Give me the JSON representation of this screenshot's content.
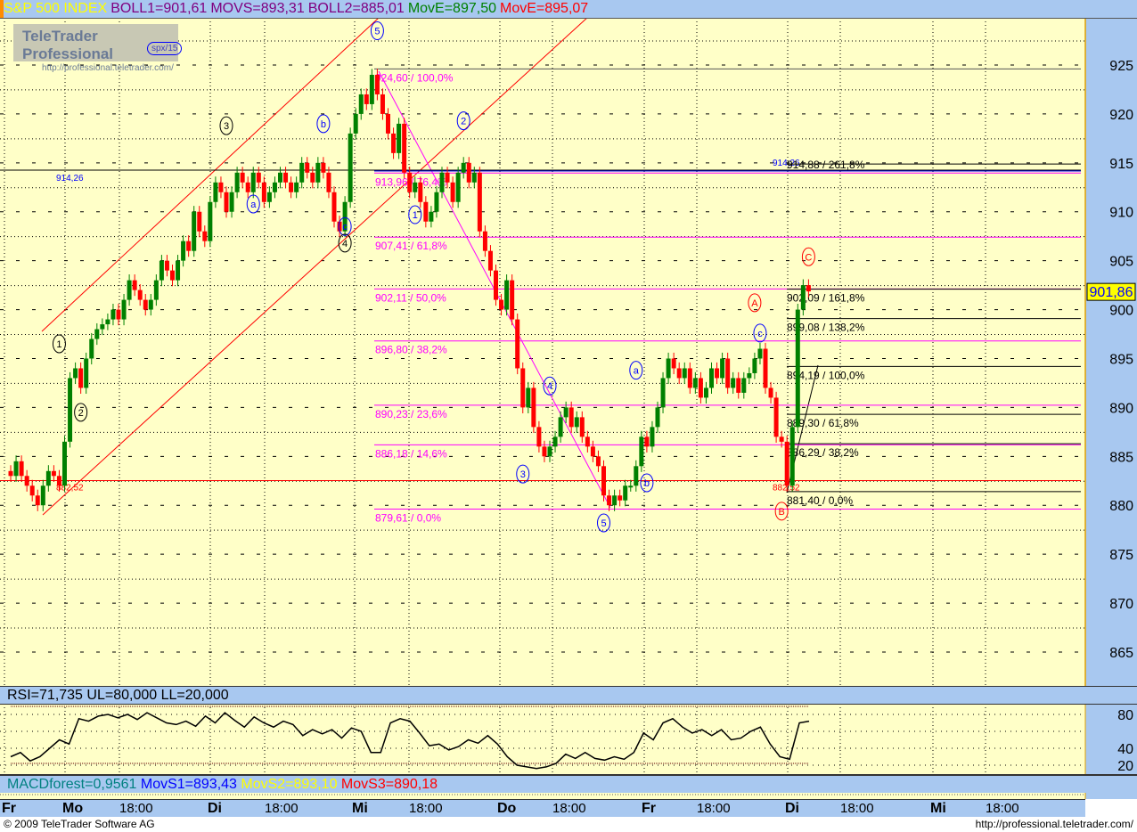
{
  "header": {
    "symbol": "S&P 500 INDEX",
    "boll1": "BOLL1=901,61",
    "movs": "MOVS=893,31",
    "boll2": "BOLL2=885,01",
    "move1": "MovE=897,50",
    "move2": "MovE=895,07"
  },
  "logo": {
    "title": "TeleTrader Professional",
    "url": "http://professional.teletrader.com/",
    "badge": "spx/15"
  },
  "rsi_header": "RSI=71,735 UL=80,000 LL=20,000",
  "macd_header": {
    "macd": "MACDforest=0,9561",
    "movs1": "MovS1=893,43",
    "movs2": "MovS2=893,10",
    "movs3": "MovS3=890,18"
  },
  "footer": {
    "copyright": "© 2009 TeleTrader Software AG",
    "url": "http://professional.teletrader.com/"
  },
  "colors": {
    "bg": "#ffffc8",
    "panel": "#a8c8f0",
    "up": "#008000",
    "down": "#ff0000",
    "fib": "#ff00ff"
  },
  "chart_data": {
    "type": "candlestick",
    "title": "S&P 500 INDEX",
    "ylim": [
      861,
      927
    ],
    "y_ticks": [
      "925",
      "920",
      "915",
      "910",
      "905",
      "900",
      "895",
      "890",
      "885",
      "880",
      "875",
      "870",
      "865"
    ],
    "last_price": "901,86",
    "x_ticks": [
      {
        "label": "Fr",
        "major": true
      },
      {
        "label": "Mo",
        "major": true
      },
      {
        "label": "18:00",
        "major": false
      },
      {
        "label": "Di",
        "major": true
      },
      {
        "label": "18:00",
        "major": false
      },
      {
        "label": "Mi",
        "major": true
      },
      {
        "label": "18:00",
        "major": false
      },
      {
        "label": "Do",
        "major": true
      },
      {
        "label": "18:00",
        "major": false
      },
      {
        "label": "Fr",
        "major": true
      },
      {
        "label": "18:00",
        "major": false
      },
      {
        "label": "Di",
        "major": true
      },
      {
        "label": "18:00",
        "major": false
      },
      {
        "label": "Mi",
        "major": true
      },
      {
        "label": "18:00",
        "major": false
      }
    ],
    "closes": [
      883,
      884.5,
      883,
      882,
      881,
      880,
      882,
      883.5,
      883,
      882,
      886.5,
      893,
      894,
      892,
      895,
      897,
      898,
      898.5,
      899,
      900,
      899,
      901,
      903,
      902,
      901,
      900,
      901,
      903,
      905,
      904,
      903,
      905,
      907,
      906,
      910,
      908,
      907,
      911,
      913,
      912,
      910,
      912,
      914,
      913,
      912,
      914,
      913,
      911,
      912,
      913,
      914,
      913,
      912,
      913,
      915,
      914,
      913,
      915,
      914,
      912,
      909,
      908,
      911,
      918,
      920,
      922,
      921,
      924,
      922,
      920,
      918,
      916,
      919,
      914,
      912,
      913,
      911,
      909,
      910,
      912,
      914,
      913,
      911,
      914,
      915,
      913,
      914,
      908,
      906,
      904,
      901,
      900,
      903,
      899,
      894,
      890,
      892,
      888,
      886,
      885,
      886,
      887,
      889,
      890,
      888,
      889,
      887,
      886,
      885,
      884,
      881,
      880,
      881,
      880.5,
      882,
      882,
      884,
      887,
      886,
      888,
      890,
      893,
      895,
      894,
      893,
      894,
      892,
      893,
      891,
      892,
      894,
      893,
      895,
      892,
      893,
      891.5,
      893,
      893.5,
      895,
      896,
      892,
      891,
      887,
      886.5,
      882,
      888,
      900,
      902.5,
      901.86
    ],
    "horizontal_levels": [
      {
        "label": "914,26",
        "price": 914.26,
        "color": "#0000ff"
      },
      {
        "label": "882,52",
        "price": 882.52,
        "color": "#ff0000"
      }
    ],
    "fib_retracement": [
      {
        "label": "924,60 / 100,0%",
        "price": 924.6
      },
      {
        "label": "913,96 / 76,4%",
        "price": 913.96
      },
      {
        "label": "907,41 / 61,8%",
        "price": 907.41
      },
      {
        "label": "902,11 / 50,0%",
        "price": 902.11
      },
      {
        "label": "896,80 / 38,2%",
        "price": 896.8
      },
      {
        "label": "890,23 / 23,6%",
        "price": 890.23
      },
      {
        "label": "886,18 / 14,6%",
        "price": 886.18
      },
      {
        "label": "879,61 / 0,0%",
        "price": 879.61
      }
    ],
    "fib_extension": [
      {
        "label": "914,88 / 261,8%",
        "price": 914.88
      },
      {
        "label": "902,09 / 161,8%",
        "price": 902.09
      },
      {
        "label": "899,08 / 138,2%",
        "price": 899.08
      },
      {
        "label": "894,19 / 100,0%",
        "price": 894.19
      },
      {
        "label": "889,30 / 61,8%",
        "price": 889.3
      },
      {
        "label": "886,29 / 38,2%",
        "price": 886.29
      },
      {
        "label": "881,40 / 0,0%",
        "price": 881.4
      }
    ],
    "wave_labels": [
      {
        "text": "1",
        "color": "#000000",
        "bar": 10,
        "price": 896.5
      },
      {
        "text": "2",
        "color": "#000000",
        "bar": 14,
        "price": 889.5
      },
      {
        "text": "3",
        "color": "#000000",
        "bar": 41,
        "price": 918.8
      },
      {
        "text": "a",
        "color": "#0000ff",
        "bar": 46,
        "price": 910.8
      },
      {
        "text": "b",
        "color": "#0000ff",
        "bar": 59,
        "price": 919
      },
      {
        "text": "c",
        "color": "#0000ff",
        "bar": 63,
        "price": 908.5
      },
      {
        "text": "4",
        "color": "#000000",
        "bar": 63,
        "price": 906.8
      },
      {
        "text": "5",
        "color": "#0000ff",
        "bar": 69,
        "price": 928.5
      },
      {
        "text": "1",
        "color": "#0000ff",
        "bar": 76,
        "price": 909.7
      },
      {
        "text": "2",
        "color": "#0000ff",
        "bar": 85,
        "price": 919.3
      },
      {
        "text": "4",
        "color": "#0000ff",
        "bar": 101,
        "price": 892.2
      },
      {
        "text": "3",
        "color": "#0000ff",
        "bar": 96,
        "price": 883.2
      },
      {
        "text": "5",
        "color": "#0000ff",
        "bar": 111,
        "price": 878.2
      },
      {
        "text": "a",
        "color": "#0000ff",
        "bar": 117,
        "price": 893.8
      },
      {
        "text": "b",
        "color": "#0000ff",
        "bar": 119,
        "price": 882.3
      },
      {
        "text": "c",
        "color": "#0000ff",
        "bar": 140,
        "price": 897.6
      },
      {
        "text": "A",
        "color": "#ff0000",
        "bar": 139,
        "price": 900.7
      },
      {
        "text": "B",
        "color": "#ff0000",
        "bar": 144,
        "price": 879.4
      },
      {
        "text": "C",
        "color": "#ff0000",
        "bar": 149,
        "price": 905.4
      }
    ],
    "rsi": {
      "ylim": [
        20,
        80
      ],
      "ticks": [
        "80",
        "40",
        "20"
      ],
      "values": [
        30,
        35,
        25,
        30,
        40,
        50,
        45,
        75,
        72,
        78,
        80,
        76,
        80,
        74,
        82,
        76,
        70,
        68,
        72,
        66,
        78,
        70,
        82,
        73,
        65,
        77,
        70,
        65,
        72,
        68,
        55,
        62,
        57,
        62,
        52,
        64,
        60,
        35,
        35,
        70,
        75,
        72,
        58,
        43,
        45,
        38,
        42,
        50,
        46,
        55,
        45,
        30,
        20,
        18,
        16,
        18,
        22,
        33,
        28,
        35,
        28,
        26,
        30,
        27,
        35,
        58,
        50,
        70,
        75,
        65,
        58,
        62,
        55,
        62,
        50,
        52,
        60,
        65,
        45,
        30,
        27,
        70,
        72
      ]
    }
  }
}
